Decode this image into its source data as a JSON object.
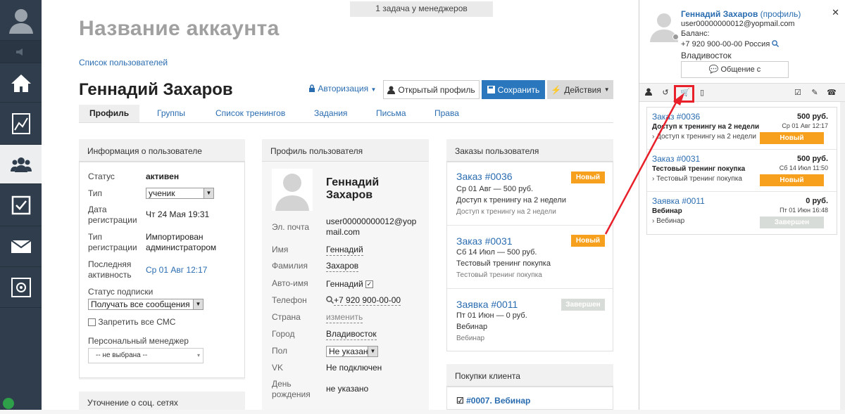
{
  "top_note": "1 задача у менеджеров",
  "account_title": "Название аккаунта",
  "breadcrumb": "Список пользователей",
  "user": {
    "name": "Геннадий Захаров"
  },
  "toolbar": {
    "auth_label": "Авторизация",
    "open_profile_label": "Открытый профиль",
    "save_label": "Сохранить",
    "actions_label": "Действия"
  },
  "tabs": [
    "Профиль",
    "Группы",
    "Список тренингов",
    "Задания",
    "Письма",
    "Права"
  ],
  "info_panel": {
    "title": "Информация о пользователе",
    "status_label": "Статус",
    "status_value": "активен",
    "type_label": "Тип",
    "type_value": "ученик",
    "reg_date_label_1": "Дата",
    "reg_date_label_2": "регистрации",
    "reg_date_value": "Чт 24 Мая 19:31",
    "reg_type_label_1": "Тип",
    "reg_type_label_2": "регистрации",
    "reg_type_value_1": "Импортирован",
    "reg_type_value_2": "администратором",
    "last_active_label_1": "Последняя",
    "last_active_label_2": "активность",
    "last_active_value": "Ср 01 Авг 12:17",
    "sub_status_label": "Статус подписки",
    "sub_status_value": "Получать все сообщения",
    "sms_label": "Запретить все СМС",
    "manager_label": "Персональный менеджер",
    "manager_value": "-- не выбрана --"
  },
  "social_panel": {
    "title": "Уточнение о соц. сетях"
  },
  "profile_panel": {
    "title": "Профиль пользователя",
    "name_1": "Геннадий",
    "name_2": "Захаров",
    "email_label": "Эл. почта",
    "email_value_1": "user00000000012@yop",
    "email_value_2": "mail.com",
    "first_name_label": "Имя",
    "first_name_value": "Геннадий",
    "last_name_label": "Фамилия",
    "last_name_value": "Захаров",
    "auto_name_label": "Авто-имя",
    "auto_name_value": "Геннадий",
    "phone_label": "Телефон",
    "phone_value": "+7 920 900-00-00",
    "country_label": "Страна",
    "country_value": "изменить",
    "city_label": "Город",
    "city_value": "Владивосток",
    "gender_label": "Пол",
    "gender_value": "Не указан",
    "vk_label": "VK",
    "vk_value": "Не подключен",
    "birthday_label_1": "День",
    "birthday_label_2": "рождения",
    "birthday_value": "не указано"
  },
  "orders_panel": {
    "title": "Заказы пользователя",
    "orders": [
      {
        "title": "Заказ #0036",
        "line1": "Ср 01 Авг — 500 руб.",
        "line2": "Доступ к тренингу на 2 недели",
        "sub": "Доступ к тренингу на 2 недели",
        "badge": "Новый",
        "status": "new"
      },
      {
        "title": "Заказ #0031",
        "line1": "Сб 14 Июл — 500 руб.",
        "line2": "Тестовый тренинг покупка",
        "sub": "Тестовый тренинг покупка",
        "badge": "Новый",
        "status": "new"
      },
      {
        "title": "Заявка #0011",
        "line1": "Пт 01 Июн — 0 руб.",
        "line2": "Вебинар",
        "sub": "Вебинар",
        "badge": "Завершен",
        "status": "done"
      }
    ]
  },
  "purchases_panel": {
    "title": "Покупки клиента",
    "item": "#0007. Вебинар"
  },
  "right_panel": {
    "name": "Геннадий Захаров",
    "profile_link": "(профиль)",
    "email": "user00000000012@yopmail.com",
    "balance_label": "Баланс:",
    "phone": "+7 920 900-00-00 Россия",
    "city": "Владивосток",
    "chat_button": "Общение с пользователем",
    "orders": [
      {
        "title": "Заказ #0036",
        "price": "500 руб.",
        "label": "Доступ к тренингу на 2 недели",
        "date": "Ср 01 Авг 12:17",
        "sub": "Доступ к тренингу на 2 недели",
        "badge": "Новый",
        "status": "new"
      },
      {
        "title": "Заказ #0031",
        "price": "500 руб.",
        "label": "Тестовый тренинг покупка",
        "date": "Сб 14 Июл 11:50",
        "sub": "Тестовый тренинг покупка",
        "badge": "Новый",
        "status": "new"
      },
      {
        "title": "Заявка #0011",
        "price": "0 руб.",
        "label": "Вебинар",
        "date": "Пт 01 Июн 16:48",
        "sub": "Вебинар",
        "badge": "Завершен",
        "status": "done"
      }
    ]
  },
  "colors": {
    "accent": "#2a77bd",
    "nav_bg": "#2f3d4c",
    "badge_new": "#f7a01d",
    "highlight": "#e8202a"
  }
}
